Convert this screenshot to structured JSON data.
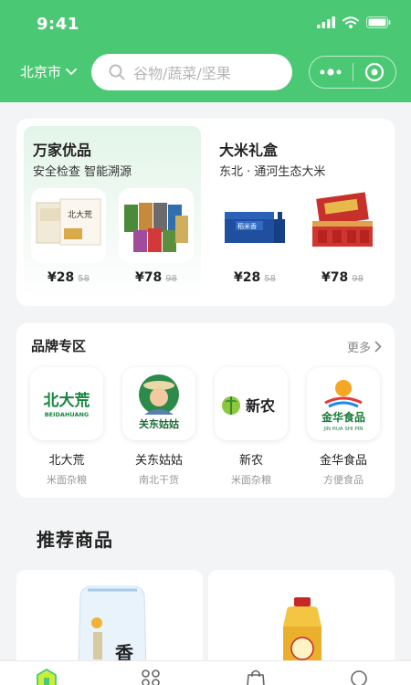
{
  "status_bar": {
    "time": "9:41"
  },
  "header": {
    "city": "北京市",
    "search_placeholder": "谷物/蔬菜/坚果"
  },
  "promo": {
    "left": {
      "title": "万家优品",
      "subtitle": "安全检查  智能溯源",
      "products": [
        {
          "price": "¥28",
          "old_price": "58"
        },
        {
          "price": "¥78",
          "old_price": "98"
        }
      ]
    },
    "right": {
      "title": "大米礼盒",
      "subtitle": "东北 · 通河生态大米",
      "products": [
        {
          "price": "¥28",
          "old_price": "58"
        },
        {
          "price": "¥78",
          "old_price": "98"
        }
      ]
    }
  },
  "brands": {
    "title": "品牌专区",
    "more_label": "更多",
    "items": [
      {
        "name": "北大荒",
        "category": "米面杂粮",
        "logo_text": "北大荒",
        "logo_sub": "BEIDAHUANG"
      },
      {
        "name": "关东姑姑",
        "category": "南北干货",
        "logo_text": "关东姑姑"
      },
      {
        "name": "新农",
        "category": "米面杂粮",
        "logo_text": "新农"
      },
      {
        "name": "金华食品",
        "category": "方便食品",
        "logo_text": "金华食品",
        "logo_sub": "JIN HUA SHI PIN"
      }
    ]
  },
  "recommend": {
    "title": "推荐商品"
  },
  "colors": {
    "brand_green": "#4bc873"
  }
}
